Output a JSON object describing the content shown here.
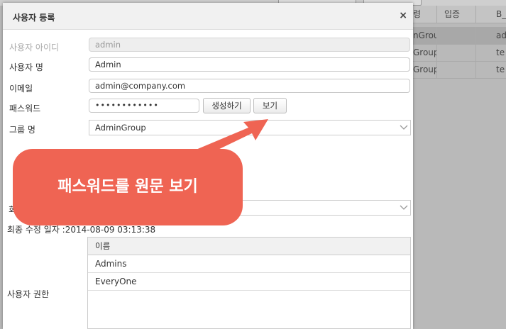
{
  "background": {
    "grid_headers": [
      "령",
      "입증",
      "B_"
    ],
    "rows": [
      [
        "nGrou",
        "",
        "ad"
      ],
      [
        "Group",
        "",
        "te"
      ],
      [
        "Group",
        "",
        "te"
      ]
    ]
  },
  "dialog": {
    "title": "사용자 등록",
    "close_icon": "×",
    "fields": {
      "user_id": {
        "label": "사용자 아이디",
        "value": "admin"
      },
      "user_name": {
        "label": "사용자 명",
        "value": "Admin"
      },
      "email": {
        "label": "이메일",
        "value": "admin@company.com"
      },
      "password": {
        "label": "패스워드",
        "value": "••••••••••••"
      },
      "group": {
        "label": "그룹 명",
        "value": "AdminGroup"
      }
    },
    "buttons": {
      "generate": "생성하기",
      "view": "보기"
    },
    "partial_label": "회",
    "last_modified": "최종 수정 일자 :2014-08-09 03:13:38",
    "permissions": {
      "label": "사용자 권한",
      "header": "이름",
      "rows": [
        "Admins",
        "EveryOne"
      ]
    }
  },
  "callout": {
    "text": "패스워드를 원문 보기",
    "color": "#ef6453"
  }
}
